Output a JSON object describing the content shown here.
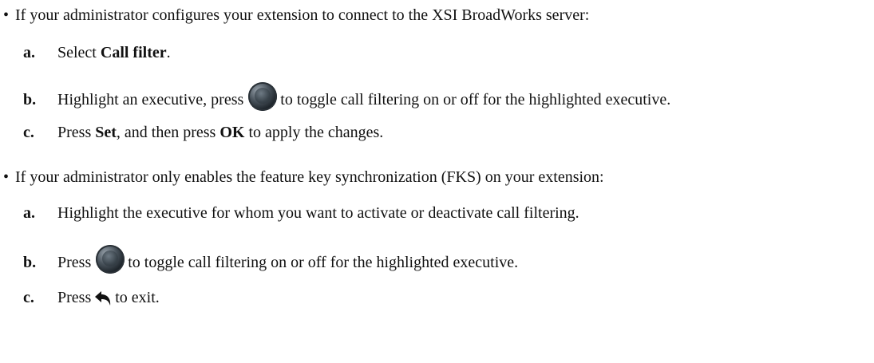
{
  "section1": {
    "bullet": "•",
    "intro": "If your administrator configures your extension to connect to the XSI BroadWorks server:",
    "step_a": {
      "letter": "a.",
      "pre": "Select ",
      "bold": "Call filter",
      "post": "."
    },
    "step_b": {
      "letter": "b.",
      "pre": "Highlight an executive, press",
      "icon": "navigation-ok-key-icon",
      "post": "to toggle call filtering on or off for the highlighted executive."
    },
    "step_c": {
      "letter": "c.",
      "pre": "Press ",
      "bold1": "Set",
      "mid": ", and then press ",
      "bold2": "OK",
      "post": " to apply the changes."
    }
  },
  "section2": {
    "bullet": "•",
    "intro": "If your administrator only enables the feature key synchronization (FKS) on your extension:",
    "step_a": {
      "letter": "a.",
      "text": "Highlight the executive for whom you want to activate or deactivate call filtering."
    },
    "step_b": {
      "letter": "b.",
      "pre": "Press",
      "icon": "navigation-ok-key-icon",
      "post": "to toggle call filtering on or off for the highlighted executive."
    },
    "step_c": {
      "letter": "c.",
      "pre": "Press",
      "icon": "back-arrow-icon",
      "post": "to exit."
    }
  }
}
